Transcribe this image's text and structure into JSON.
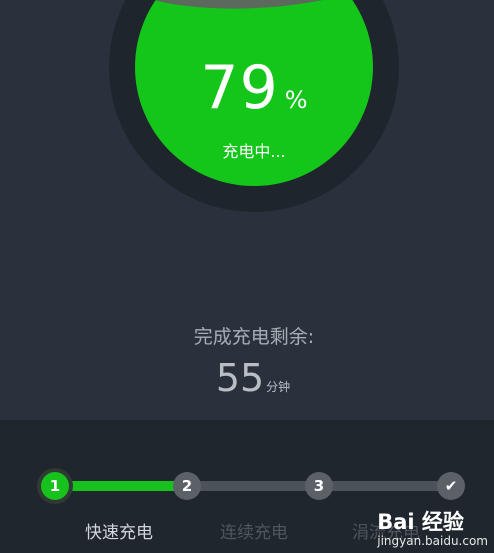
{
  "battery": {
    "level_percent": 79,
    "percent_value": "79",
    "percent_sign": "%",
    "status": "充电中...",
    "fill_color": "#14c51a"
  },
  "remaining": {
    "label": "完成充电剩余:",
    "value": "55",
    "unit": "分钟"
  },
  "steps": {
    "items": [
      {
        "number": "1",
        "label": "快速充电",
        "state": "active"
      },
      {
        "number": "2",
        "label": "连续充电",
        "state": "pending"
      },
      {
        "number": "3",
        "label": "涓流充电",
        "state": "pending"
      }
    ],
    "accent_color": "#18c21d"
  },
  "watermark": {
    "main": "Bai 经验",
    "sub": "jingyan.baidu.com"
  }
}
